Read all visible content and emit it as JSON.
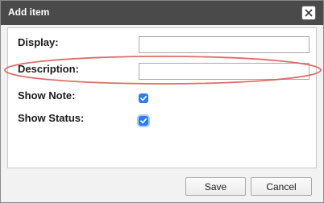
{
  "dialog": {
    "title": "Add item",
    "close_icon": "close-x-icon"
  },
  "form": {
    "display_label": "Display:",
    "display_value": "",
    "description_label": "Description:",
    "description_value": "",
    "show_note_label": "Show Note:",
    "show_note_checked": true,
    "show_status_label": "Show Status:",
    "show_status_checked": true
  },
  "footer": {
    "save_label": "Save",
    "cancel_label": "Cancel"
  },
  "colors": {
    "titlebar": "#4a4a4a",
    "checkbox_accent": "#2d7cf2",
    "annotation_ellipse": "#d9534f"
  }
}
